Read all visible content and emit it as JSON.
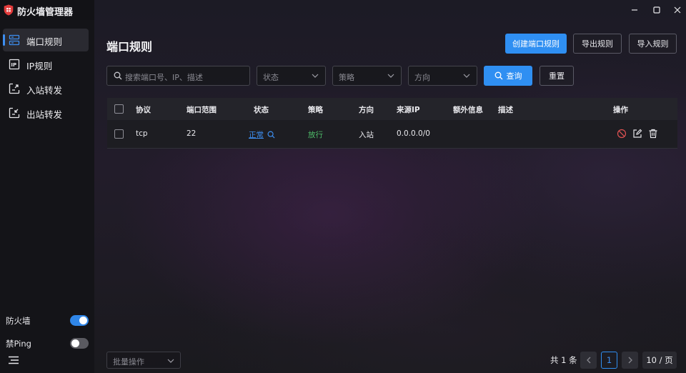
{
  "app": {
    "title": "防火墙管理器"
  },
  "window_controls": [
    "minimize-icon",
    "maximize-icon",
    "close-icon"
  ],
  "sidebar": {
    "items": [
      {
        "label": "端口规则",
        "icon": "server-rack-icon",
        "active": true
      },
      {
        "label": "IP规则",
        "icon": "ip-icon",
        "active": false
      },
      {
        "label": "入站转发",
        "icon": "inbound-forward-icon",
        "active": false
      },
      {
        "label": "出站转发",
        "icon": "outbound-forward-icon",
        "active": false
      }
    ],
    "toggles": [
      {
        "label": "防火墙",
        "on": true
      },
      {
        "label": "禁Ping",
        "on": false
      }
    ]
  },
  "main": {
    "title": "端口规则",
    "actions": {
      "create": "创建端口规则",
      "export": "导出规则",
      "import": "导入规则"
    },
    "filters": {
      "search_placeholder": "搜索端口号、IP、描述",
      "status_placeholder": "状态",
      "policy_placeholder": "策略",
      "direction_placeholder": "方向",
      "query_label": "查询",
      "reset_label": "重置"
    },
    "table": {
      "headers": {
        "protocol": "协议",
        "port_range": "端口范围",
        "status": "状态",
        "policy": "策略",
        "direction": "方向",
        "source_ip": "来源IP",
        "extra": "额外信息",
        "description": "描述",
        "operations": "操作"
      },
      "rows": [
        {
          "protocol": "tcp",
          "port_range": "22",
          "status": "正常",
          "policy": "放行",
          "direction": "入站",
          "source_ip": "0.0.0.0/0",
          "extra": "",
          "description": ""
        }
      ]
    },
    "footer": {
      "bulk_placeholder": "批量操作",
      "total": "共 1 条",
      "current_page": "1",
      "page_size": "10 / 页"
    }
  },
  "colors": {
    "accent": "#2f8ff2",
    "link": "#3d8ef0",
    "success": "#4fbf6a",
    "danger": "#e05252"
  }
}
